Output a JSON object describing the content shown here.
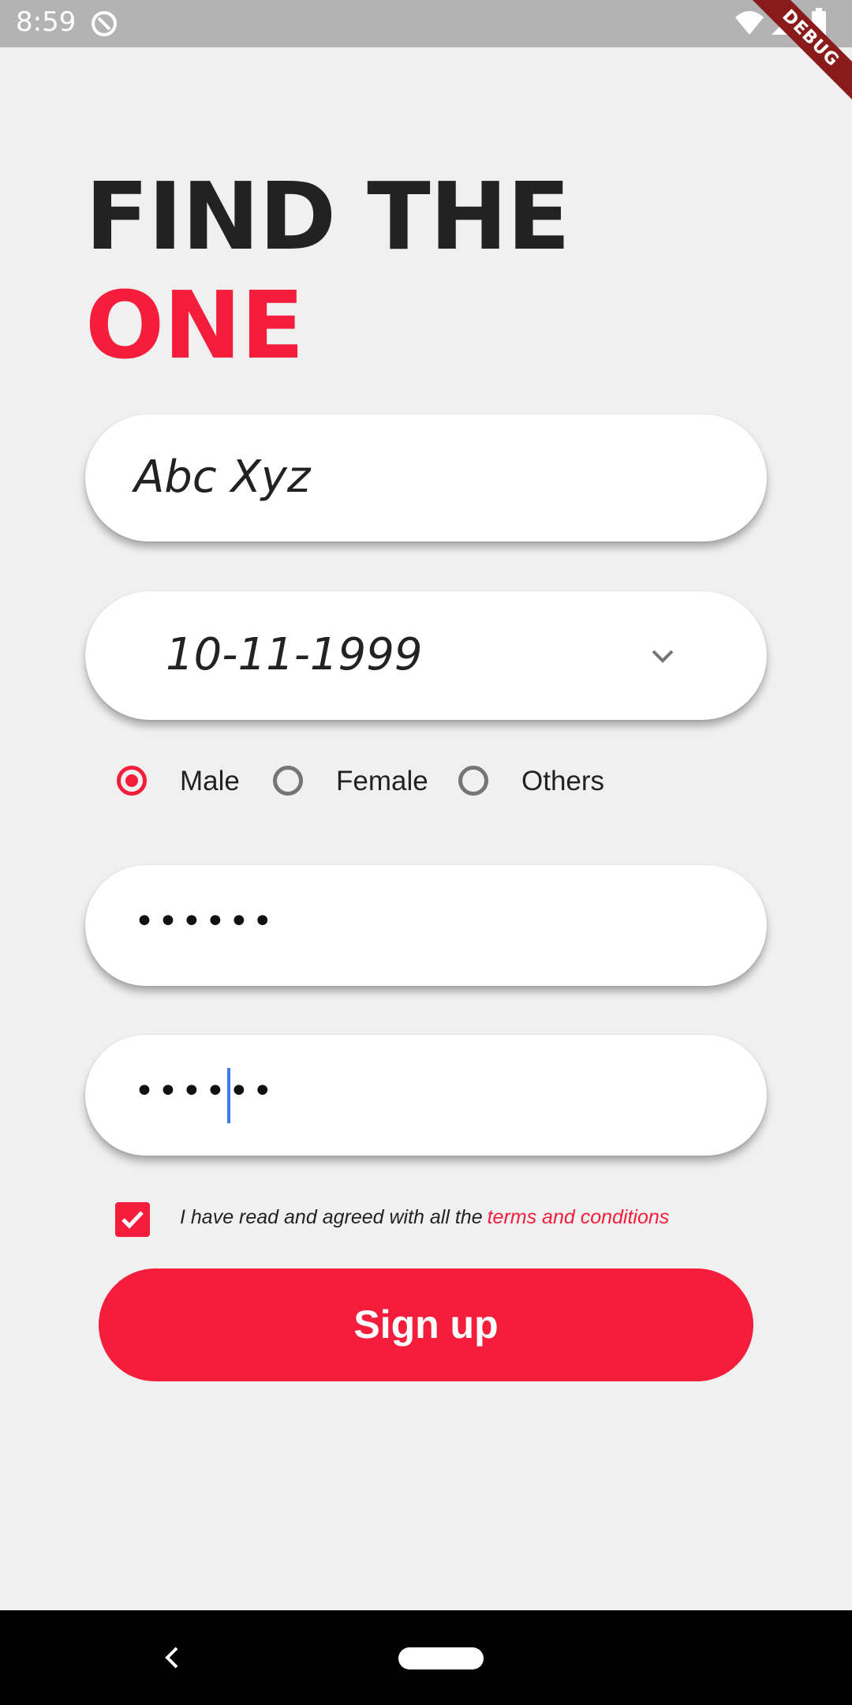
{
  "status_bar": {
    "time": "8:59",
    "debug_label": "DEBUG"
  },
  "heading": {
    "line1": "FIND THE",
    "line2": "ONE"
  },
  "form": {
    "name_value": "Abc Xyz",
    "dob_value": "10-11-1999",
    "gender_options": [
      "Male",
      "Female",
      "Others"
    ],
    "gender_selected": "Male",
    "password_mask": "••••••",
    "confirm_password_mask": "••••••",
    "terms_checked": true,
    "terms_text": "I have read and agreed with all the",
    "terms_link": "terms and conditions",
    "signup_label": "Sign up"
  },
  "colors": {
    "accent": "#f51d3c",
    "background": "#f0f0f0",
    "status_bar": "#b3b3b3",
    "caret": "#3b7cf0"
  },
  "icons": {
    "dropdown": "chevron-down-icon",
    "checkbox": "check-icon",
    "nav_back": "back-icon",
    "nav_home": "home-pill-icon"
  }
}
